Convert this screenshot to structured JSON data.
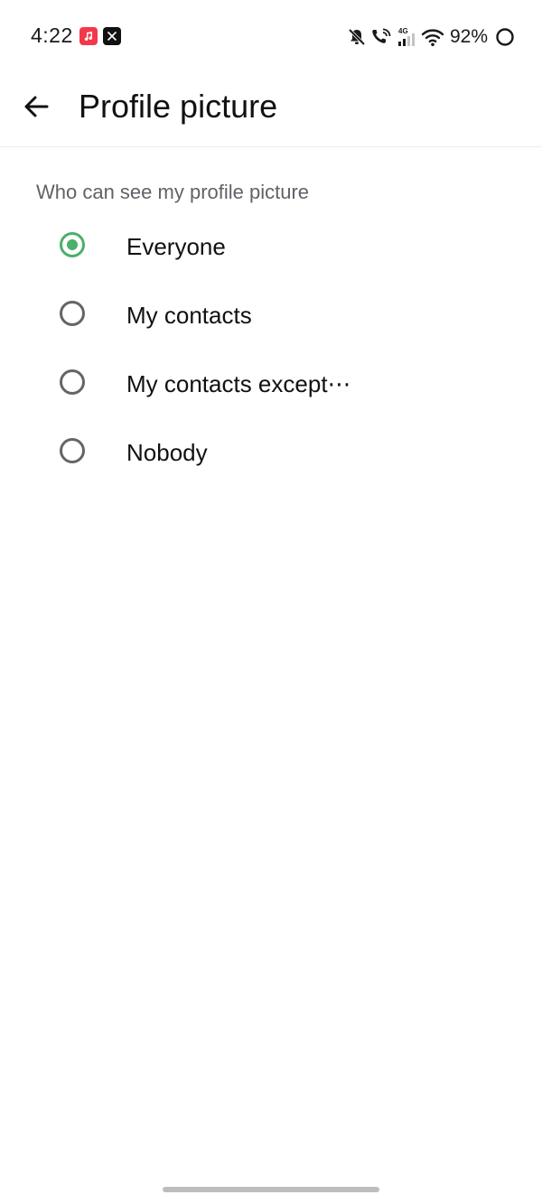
{
  "status_bar": {
    "time": "4:22",
    "network": "4G",
    "battery_percent": "92%",
    "icons": [
      "music-app-icon",
      "x-app-icon",
      "bell-off-icon",
      "wifi-call-icon",
      "signal-icon",
      "wifi-icon",
      "battery-ring-icon"
    ],
    "colors": {
      "music_badge": "#f2394b",
      "x_badge": "#111111"
    }
  },
  "app_bar": {
    "back_icon": "arrow-left-icon",
    "title": "Profile picture"
  },
  "section": {
    "header": "Who can see my profile picture",
    "selected_index": 0,
    "options": [
      {
        "label": "Everyone",
        "selected": true
      },
      {
        "label": "My contacts",
        "selected": false
      },
      {
        "label": "My contacts except⋯",
        "selected": false
      },
      {
        "label": "Nobody",
        "selected": false
      }
    ]
  },
  "colors": {
    "accent": "#4caf6c",
    "radio_unselected": "#636669",
    "secondary_text": "#5f6368"
  }
}
